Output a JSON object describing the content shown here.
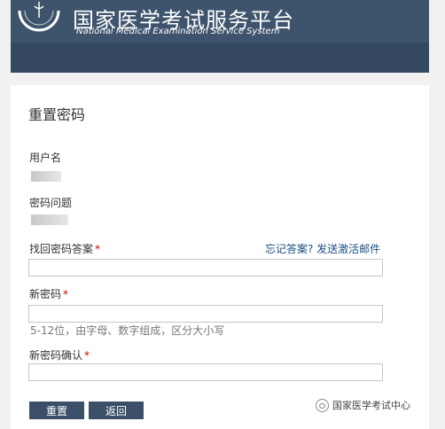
{
  "header": {
    "title": "国家医学考试服务平台",
    "subtitle": "National Medical Examination Service System"
  },
  "form": {
    "title": "重置密码",
    "username_label": "用户名",
    "question_label": "密码问题",
    "answer_label": "找回密码答案",
    "forgot_link": "忘记答案? 发送激活邮件",
    "new_password_label": "新密码",
    "password_hint": "5-12位，由字母、数字组成，区分大小写",
    "confirm_label": "新密码确认",
    "required_mark": "*",
    "answer_value": "",
    "new_password_value": "",
    "confirm_value": ""
  },
  "buttons": {
    "reset": "重置",
    "back": "返回"
  },
  "watermark": {
    "text": "国家医学考试中心",
    "icon": "wechat-icon"
  },
  "colors": {
    "header_bg": "#3e546d",
    "button_bg": "#3b5068",
    "required": "#cc0000",
    "link": "#1a4f80"
  }
}
